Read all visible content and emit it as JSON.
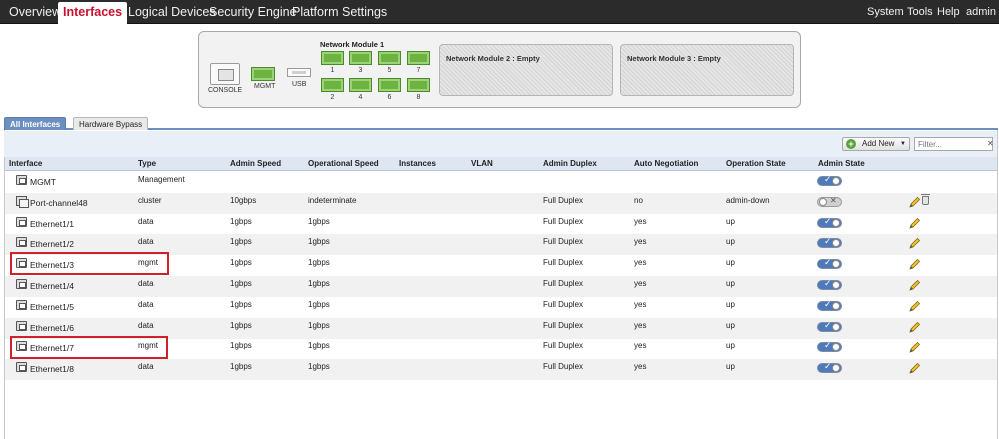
{
  "nav": {
    "tabs": [
      {
        "label": "Overview"
      },
      {
        "label": "Interfaces"
      },
      {
        "label": "Logical Devices"
      },
      {
        "label": "Security Engine"
      },
      {
        "label": "Platform Settings"
      }
    ],
    "right": [
      {
        "label": "System"
      },
      {
        "label": "Tools"
      },
      {
        "label": "Help"
      },
      {
        "label": "admin"
      }
    ]
  },
  "chassis": {
    "console_label": "CONSOLE",
    "mgmt_label": "MGMT",
    "usb_label": "USB",
    "module1_title": "Network Module 1",
    "ports_top": [
      "1",
      "3",
      "5",
      "7"
    ],
    "ports_bottom": [
      "2",
      "4",
      "6",
      "8"
    ],
    "module2": "Network Module 2 : Empty",
    "module3": "Network Module 3 : Empty",
    "port_color": "#6db33f"
  },
  "subtabs": [
    {
      "label": "All Interfaces"
    },
    {
      "label": "Hardware Bypass"
    }
  ],
  "toolbar": {
    "add_label": "Add New",
    "filter_placeholder": "Filter...",
    "filter_clear": "✕"
  },
  "table": {
    "headers": [
      "Interface",
      "Type",
      "Admin Speed",
      "Operational Speed",
      "Instances",
      "VLAN",
      "Admin Duplex",
      "Auto Negotiation",
      "Operation State",
      "Admin State"
    ],
    "rows": [
      {
        "name": "MGMT",
        "type": "Management",
        "admin_speed": "",
        "op_speed": "",
        "duplex": "",
        "auto": "",
        "state": "",
        "enabled": true
      },
      {
        "name": "Port-channel48",
        "type": "cluster",
        "admin_speed": "10gbps",
        "op_speed": "indeterminate",
        "duplex": "Full Duplex",
        "auto": "no",
        "state": "admin-down",
        "enabled": false
      },
      {
        "name": "Ethernet1/1",
        "type": "data",
        "admin_speed": "1gbps",
        "op_speed": "1gbps",
        "duplex": "Full Duplex",
        "auto": "yes",
        "state": "up",
        "enabled": true
      },
      {
        "name": "Ethernet1/2",
        "type": "data",
        "admin_speed": "1gbps",
        "op_speed": "1gbps",
        "duplex": "Full Duplex",
        "auto": "yes",
        "state": "up",
        "enabled": true
      },
      {
        "name": "Ethernet1/3",
        "type": "mgmt",
        "admin_speed": "1gbps",
        "op_speed": "1gbps",
        "duplex": "Full Duplex",
        "auto": "yes",
        "state": "up",
        "enabled": true
      },
      {
        "name": "Ethernet1/4",
        "type": "data",
        "admin_speed": "1gbps",
        "op_speed": "1gbps",
        "duplex": "Full Duplex",
        "auto": "yes",
        "state": "up",
        "enabled": true
      },
      {
        "name": "Ethernet1/5",
        "type": "data",
        "admin_speed": "1gbps",
        "op_speed": "1gbps",
        "duplex": "Full Duplex",
        "auto": "yes",
        "state": "up",
        "enabled": true
      },
      {
        "name": "Ethernet1/6",
        "type": "data",
        "admin_speed": "1gbps",
        "op_speed": "1gbps",
        "duplex": "Full Duplex",
        "auto": "yes",
        "state": "up",
        "enabled": true
      },
      {
        "name": "Ethernet1/7",
        "type": "mgmt",
        "admin_speed": "1gbps",
        "op_speed": "1gbps",
        "duplex": "Full Duplex",
        "auto": "yes",
        "state": "up",
        "enabled": true
      },
      {
        "name": "Ethernet1/8",
        "type": "data",
        "admin_speed": "1gbps",
        "op_speed": "1gbps",
        "duplex": "Full Duplex",
        "auto": "yes",
        "state": "up",
        "enabled": true
      }
    ]
  }
}
